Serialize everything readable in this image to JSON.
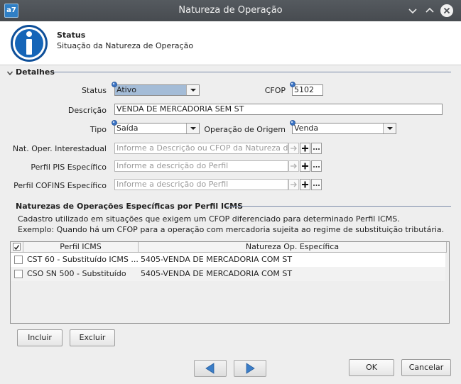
{
  "window": {
    "title": "Natureza de Operação"
  },
  "header": {
    "title": "Status",
    "subtitle": "Situação da Natureza de Operação"
  },
  "section_detalhes": {
    "title": "Detalhes"
  },
  "form": {
    "status": {
      "label": "Status",
      "value": "Ativo"
    },
    "cfop": {
      "label": "CFOP",
      "value": "5102"
    },
    "descricao": {
      "label": "Descrição",
      "value": "VENDA DE MERCADORIA SEM ST"
    },
    "tipo": {
      "label": "Tipo",
      "value": "Saída"
    },
    "operacao_origem": {
      "label": "Operação de Origem",
      "value": "Venda"
    },
    "nat_oper_interestadual": {
      "label": "Nat. Oper. Interestadual",
      "placeholder": "Informe a Descrição ou CFOP da Natureza de"
    },
    "perfil_pis": {
      "label": "Perfil PIS Específico",
      "placeholder": "Informe a descrição do Perfil"
    },
    "perfil_cofins": {
      "label": "Perfil COFINS Específico",
      "placeholder": "Informe a descrição do Perfil"
    }
  },
  "section_icms": {
    "title": "Naturezas de Operações Específicas por Perfil ICMS",
    "desc_line1": "Cadastro utilizado em situações que exigem um CFOP diferenciado para determinado Perfil ICMS.",
    "desc_line2": "Exemplo: Quando há um CFOP para a operação com mercadoria sujeita ao regime de substituição tributária."
  },
  "table": {
    "columns": [
      "Perfil ICMS",
      "Natureza Op. Específica"
    ],
    "header_checked": true,
    "rows": [
      {
        "perfil": "CST 60 - Substituído ICMS ...",
        "natureza": "5405-VENDA DE MERCADORIA COM ST",
        "checked": false
      },
      {
        "perfil": "CSO SN 500 - Substituído",
        "natureza": "5405-VENDA DE MERCADORIA COM ST",
        "checked": false
      }
    ]
  },
  "buttons": {
    "incluir": "Incluir",
    "excluir": "Excluir",
    "ok": "OK",
    "cancelar": "Cancelar"
  },
  "colors": {
    "titlebar": "#4b4f54",
    "selection": "#a4bcd7",
    "info_icon": "#1565b8",
    "nav_arrow": "#3b7ec8"
  }
}
